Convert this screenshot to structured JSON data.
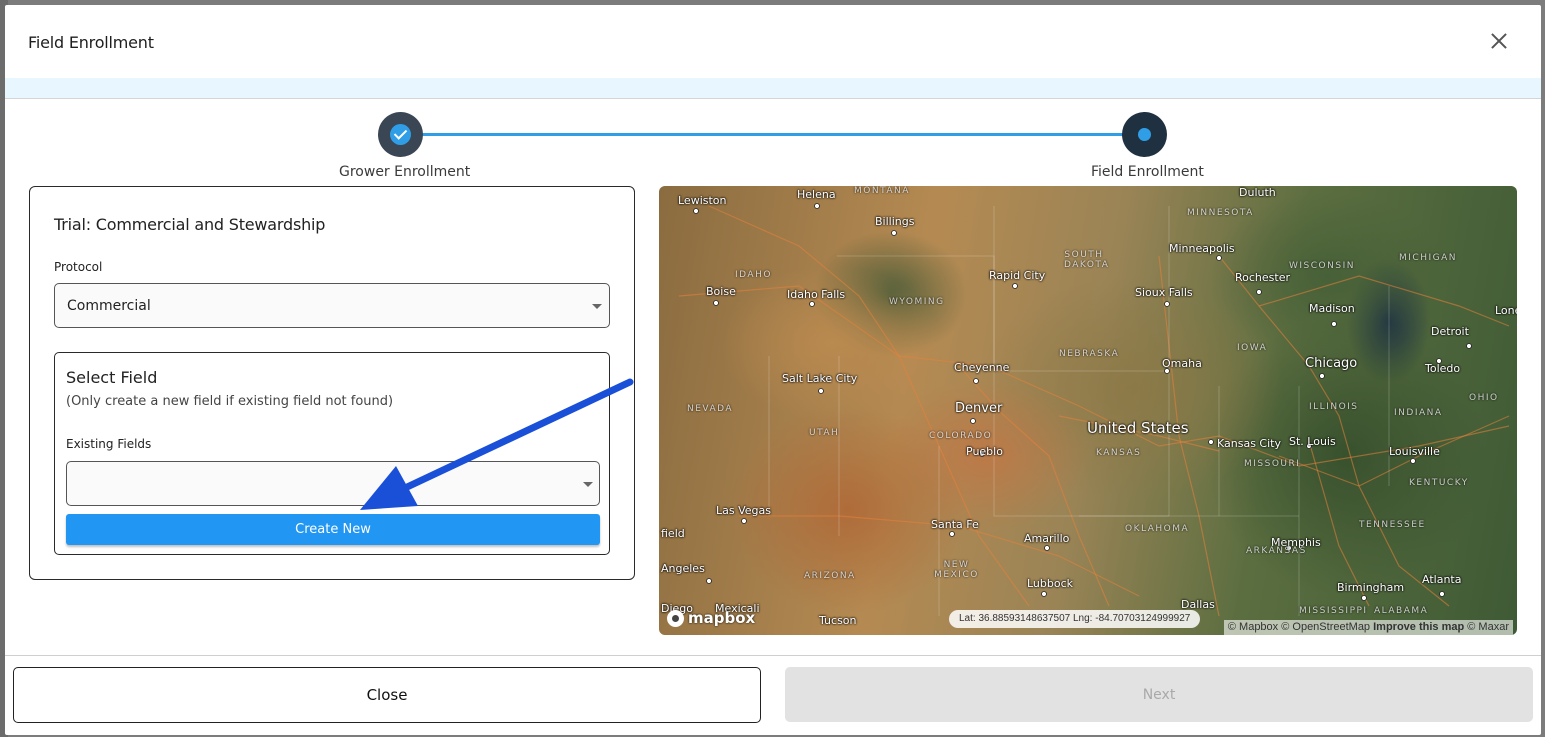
{
  "modal": {
    "title": "Field Enrollment"
  },
  "stepper": {
    "steps": [
      {
        "label": "Grower Enrollment",
        "state": "complete"
      },
      {
        "label": "Field Enrollment",
        "state": "active"
      }
    ]
  },
  "form": {
    "trial_title": "Trial: Commercial and Stewardship",
    "protocol_label": "Protocol",
    "protocol_value": "Commercial",
    "select_field": {
      "title": "Select Field",
      "subtitle": "(Only create a new field if existing field not found)",
      "existing_fields_label": "Existing Fields",
      "existing_fields_value": "",
      "create_new_label": "Create New"
    }
  },
  "map": {
    "cities": [
      "Lewiston",
      "Helena",
      "Billings",
      "Boise",
      "Idaho Falls",
      "Rapid City",
      "Minneapolis",
      "Rochester",
      "Sioux Falls",
      "Madison",
      "Detroit",
      "Chicago",
      "Toledo",
      "Salt Lake City",
      "Cheyenne",
      "Omaha",
      "Denver",
      "Kansas City",
      "St. Louis",
      "Louisville",
      "Pueblo",
      "Las Vegas",
      "Santa Fe",
      "Amarillo",
      "Memphis",
      "Angeles",
      "Lubbock",
      "Birmingham",
      "Atlanta",
      "Duluth",
      "Tucson",
      "Diego",
      "Mexicali",
      "Dallas",
      "field",
      "Lone"
    ],
    "country_label": "United States",
    "states": [
      "MONTANA",
      "MINNESOTA",
      "SOUTH DAKOTA",
      "WISCONSIN",
      "MICHIGAN",
      "IDAHO",
      "WYOMING",
      "NEBRASKA",
      "IOWA",
      "NEVADA",
      "UTAH",
      "COLORADO",
      "KANSAS",
      "MISSOURI",
      "ILLINOIS",
      "INDIANA",
      "OHIO",
      "KENTUCKY",
      "TENNESSEE",
      "OKLAHOMA",
      "ARKANSAS",
      "ARIZONA",
      "NEW MEXICO",
      "MISSISSIPPI",
      "ALABAMA"
    ],
    "coords_text": "Lat: 36.88593148637507 Lng: -84.70703124999927",
    "attribution": {
      "mapbox": "© Mapbox",
      "osm": "© OpenStreetMap",
      "improve": "Improve this map",
      "maxar": "© Maxar"
    },
    "logo_text": "mapbox"
  },
  "footer": {
    "close_label": "Close",
    "next_label": "Next"
  },
  "colors": {
    "accent": "#2196f3",
    "step_line": "#2f9ee6",
    "annotation_arrow": "#1a4fd8"
  }
}
